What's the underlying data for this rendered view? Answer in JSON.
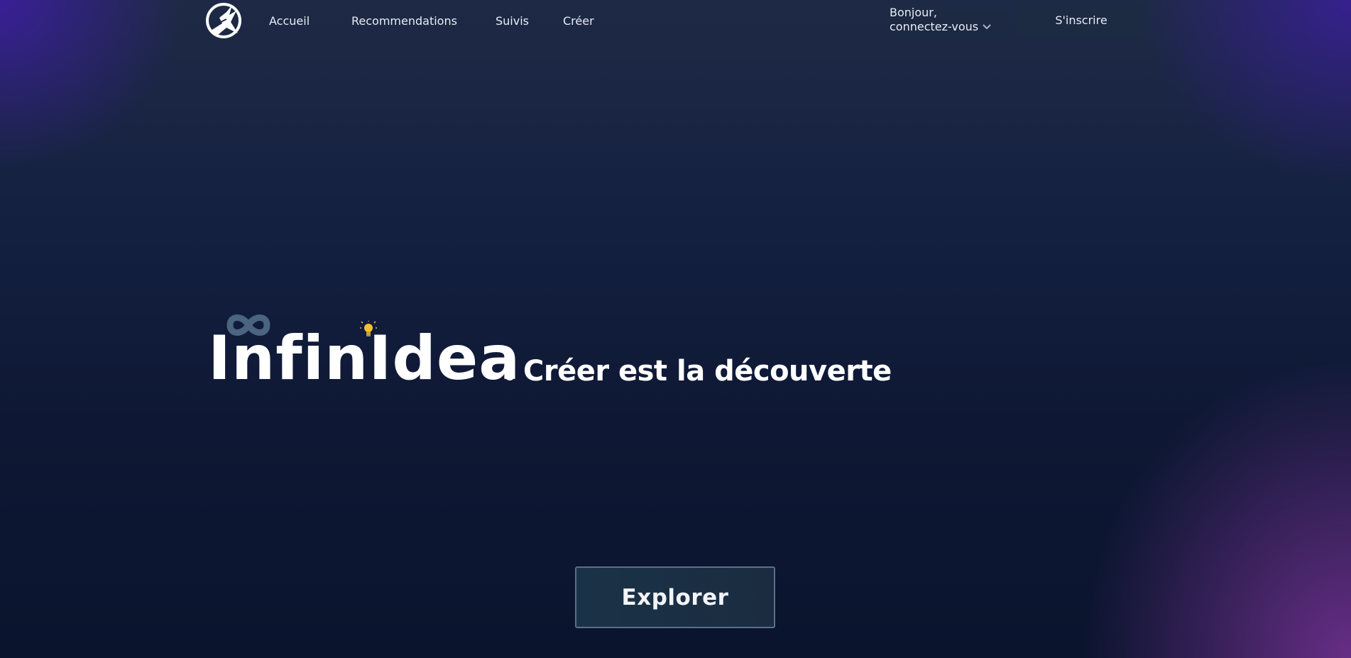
{
  "nav": {
    "links": [
      {
        "label": "Accueil"
      },
      {
        "label": "Recommendations"
      },
      {
        "label": "Suivis"
      },
      {
        "label": "Créer"
      }
    ],
    "greeting_line1": "Bonjour,",
    "greeting_line2": "connectez-vous",
    "signup_label": "S'inscrire"
  },
  "hero": {
    "brand": "InfinIdea",
    "tagline": "Créer est la découverte",
    "explore_label": "Explorer"
  },
  "icons": {
    "logo": "bird-circle-logo",
    "greeting_dropdown": "chevron-down-icon",
    "brand_decoration_1": "infinity-icon",
    "brand_decoration_2": "lightbulb-icon"
  },
  "colors": {
    "background": "#0e1834",
    "accent_purple": "#5a2f7f",
    "button_bg": "#1c2a42",
    "infinity": "#4b6480",
    "bulb": "#f2c230"
  }
}
